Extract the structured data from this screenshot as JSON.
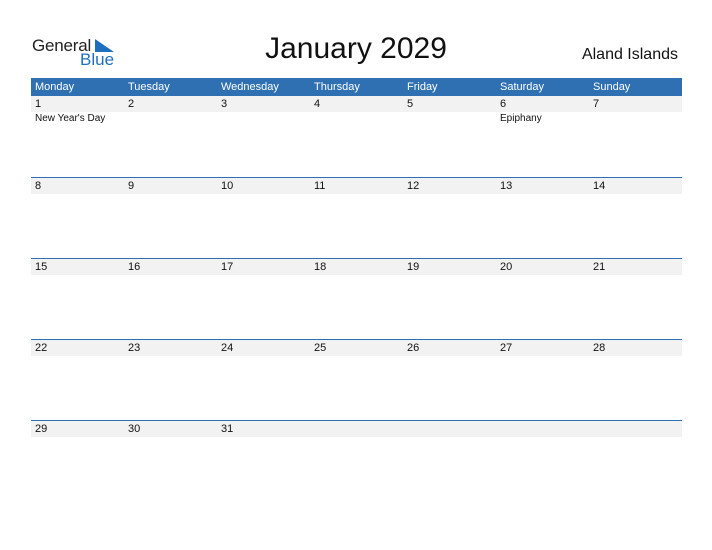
{
  "logo": {
    "general": "General",
    "blue": "Blue"
  },
  "title": "January 2029",
  "country": "Aland Islands",
  "colors": {
    "accent": "#2E70B2",
    "day_strip": "#F2F2F2"
  },
  "weekdays": [
    "Monday",
    "Tuesday",
    "Wednesday",
    "Thursday",
    "Friday",
    "Saturday",
    "Sunday"
  ],
  "weeks": [
    [
      {
        "d": "1",
        "h": "New Year's Day"
      },
      {
        "d": "2",
        "h": ""
      },
      {
        "d": "3",
        "h": ""
      },
      {
        "d": "4",
        "h": ""
      },
      {
        "d": "5",
        "h": ""
      },
      {
        "d": "6",
        "h": "Epiphany"
      },
      {
        "d": "7",
        "h": ""
      }
    ],
    [
      {
        "d": "8",
        "h": ""
      },
      {
        "d": "9",
        "h": ""
      },
      {
        "d": "10",
        "h": ""
      },
      {
        "d": "11",
        "h": ""
      },
      {
        "d": "12",
        "h": ""
      },
      {
        "d": "13",
        "h": ""
      },
      {
        "d": "14",
        "h": ""
      }
    ],
    [
      {
        "d": "15",
        "h": ""
      },
      {
        "d": "16",
        "h": ""
      },
      {
        "d": "17",
        "h": ""
      },
      {
        "d": "18",
        "h": ""
      },
      {
        "d": "19",
        "h": ""
      },
      {
        "d": "20",
        "h": ""
      },
      {
        "d": "21",
        "h": ""
      }
    ],
    [
      {
        "d": "22",
        "h": ""
      },
      {
        "d": "23",
        "h": ""
      },
      {
        "d": "24",
        "h": ""
      },
      {
        "d": "25",
        "h": ""
      },
      {
        "d": "26",
        "h": ""
      },
      {
        "d": "27",
        "h": ""
      },
      {
        "d": "28",
        "h": ""
      }
    ],
    [
      {
        "d": "29",
        "h": ""
      },
      {
        "d": "30",
        "h": ""
      },
      {
        "d": "31",
        "h": ""
      },
      {
        "d": "",
        "h": ""
      },
      {
        "d": "",
        "h": ""
      },
      {
        "d": "",
        "h": ""
      },
      {
        "d": "",
        "h": ""
      }
    ]
  ]
}
